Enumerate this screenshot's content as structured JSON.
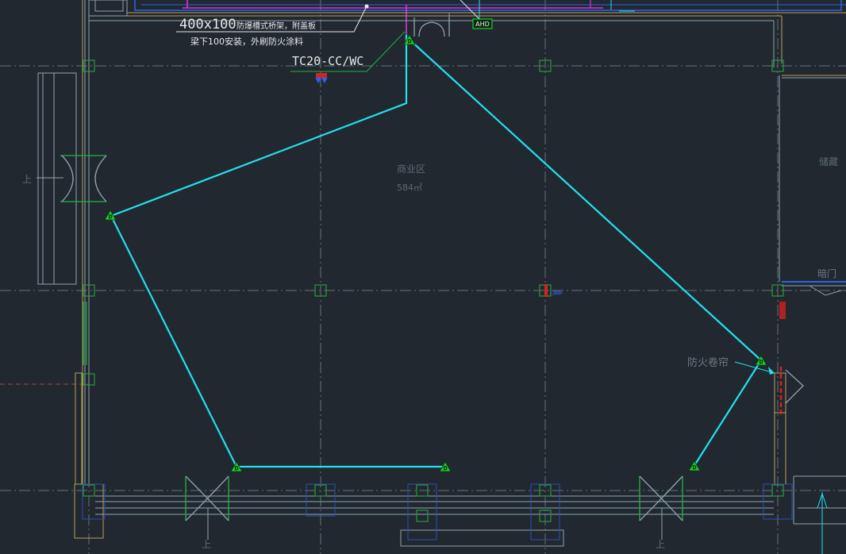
{
  "colors": {
    "background": "#212830",
    "wire": "#22e0ee",
    "wall": "#8fa3b0",
    "grid": "#7d8790",
    "column": "#2a9a3a",
    "door": "#1fb83a",
    "leader": "#e8e8e8",
    "tray_blue": "#2c63e8",
    "tray_magenta": "#e030d8",
    "fire_red": "#d82020",
    "beam": "#b9a05a",
    "dim_text": "#5c6b76"
  },
  "annotations": {
    "cable_tray_line1": "400x100",
    "cable_tray_line1b": "防爆槽式桥架，附盖板",
    "cable_tray_line2": "梁下100安装，外刷防火涂料",
    "cable_spec": "TC20-CC/WC",
    "ahd_box": "AHD"
  },
  "rooms": {
    "main_name": "商业区",
    "main_area": "584㎡",
    "right_top": "储藏",
    "right_mid": "暗门",
    "fire_shutter": "防火卷帘"
  },
  "stairs": {
    "left": "上",
    "bottom_left": "上",
    "bottom_right": "上"
  },
  "devices": [
    {
      "name": "detector-1",
      "label": "D"
    },
    {
      "name": "detector-2",
      "label": "D"
    },
    {
      "name": "detector-3",
      "label": "D"
    },
    {
      "name": "detector-4",
      "label": "D"
    },
    {
      "name": "detector-5",
      "label": "D"
    },
    {
      "name": "detector-6",
      "label": "D"
    }
  ]
}
